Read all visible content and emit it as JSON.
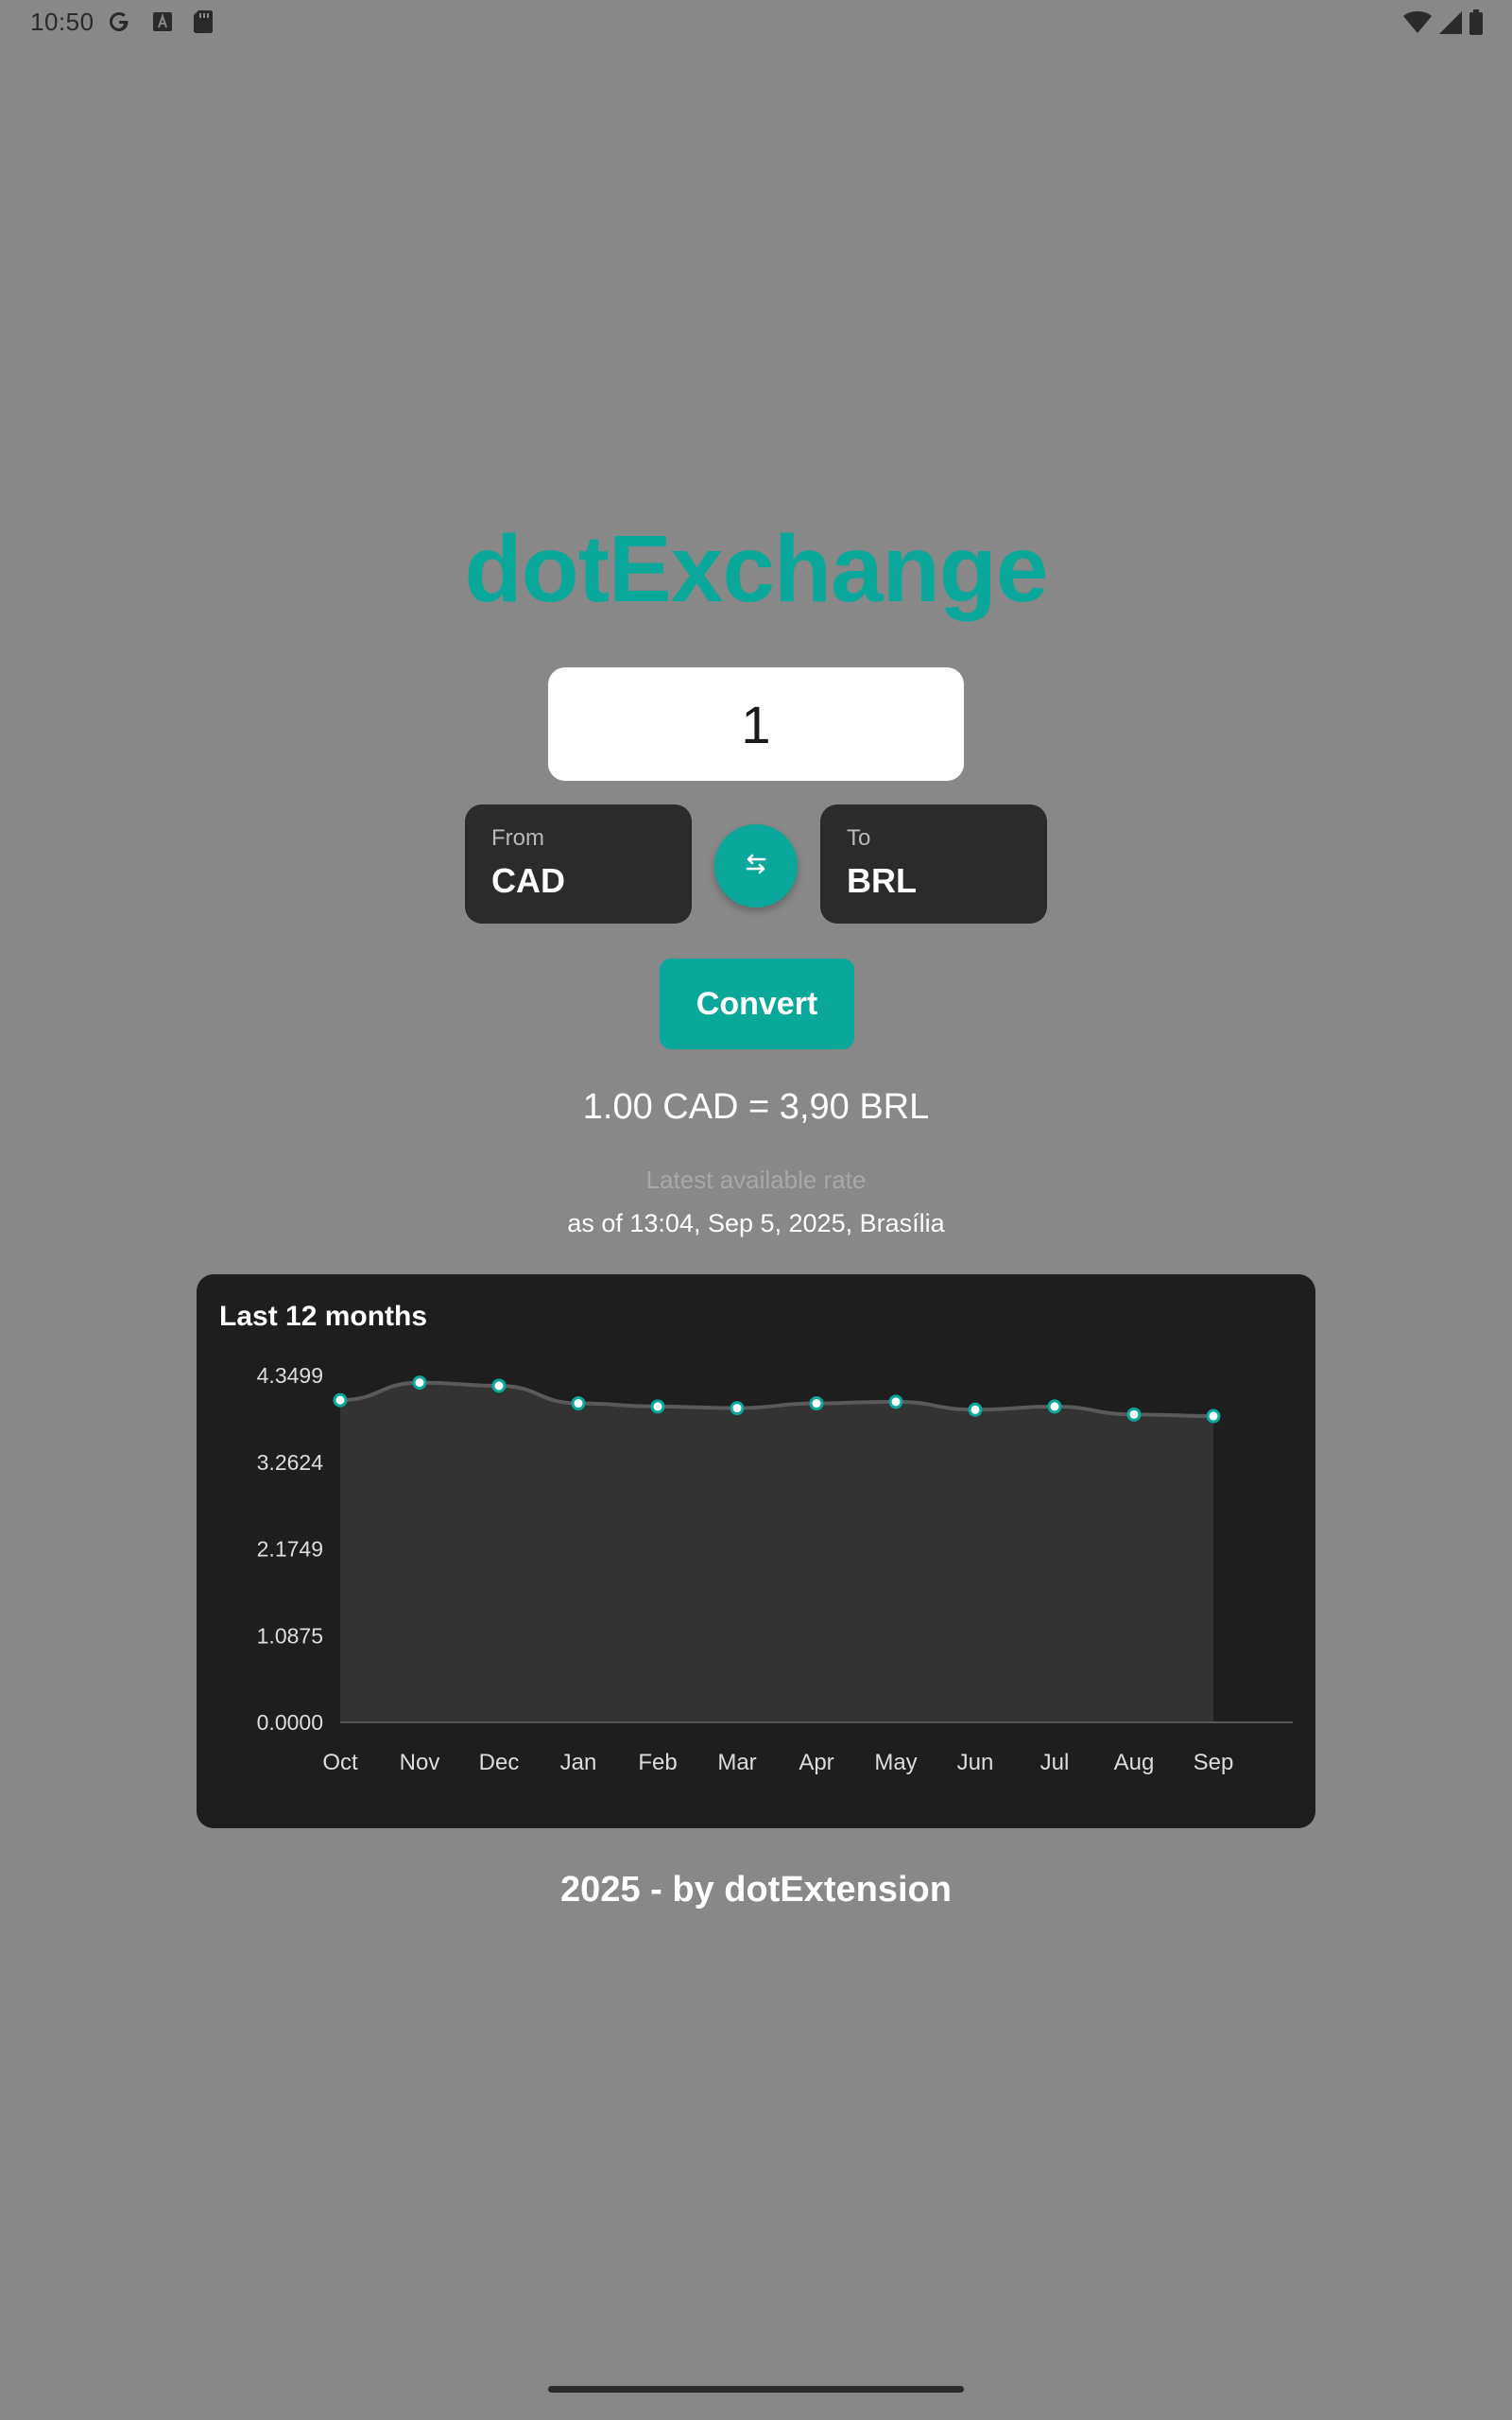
{
  "status_bar": {
    "time": "10:50",
    "left_icons": [
      "google-g-icon",
      "text-a-icon",
      "sd-card-icon"
    ],
    "right_icons": [
      "wifi-icon",
      "cell-signal-icon",
      "battery-icon"
    ]
  },
  "app": {
    "title": "dotExchange",
    "accent_color": "#0aa89b",
    "background_color": "#888888"
  },
  "amount": {
    "value": "1"
  },
  "from": {
    "label": "From",
    "code": "CAD"
  },
  "to": {
    "label": "To",
    "code": "BRL"
  },
  "swap": {
    "icon": "swap-arrows-icon"
  },
  "convert": {
    "label": "Convert"
  },
  "result": {
    "text": "1.00 CAD = 3,90 BRL",
    "note": "Latest available rate",
    "timestamp": "as of 13:04, Sep 5, 2025, Brasília"
  },
  "chart": {
    "title": "Last 12 months"
  },
  "chart_data": {
    "type": "area",
    "title": "Last 12 months",
    "categories": [
      "Oct",
      "Nov",
      "Dec",
      "Jan",
      "Feb",
      "Mar",
      "Apr",
      "May",
      "Jun",
      "Jul",
      "Aug",
      "Sep"
    ],
    "values": [
      4.04,
      4.26,
      4.22,
      4.0,
      3.96,
      3.94,
      4.0,
      4.02,
      3.92,
      3.96,
      3.86,
      3.84
    ],
    "y_ticks": [
      "4.3499",
      "3.2624",
      "2.1749",
      "1.0875",
      "0.0000"
    ],
    "ylim": [
      0,
      4.3499
    ],
    "grid": false,
    "line_color": "#5a5a5a",
    "point_color": "#0aa89b",
    "fill_color": "#333333"
  },
  "footer": {
    "text": "2025 - by dotExtension"
  }
}
